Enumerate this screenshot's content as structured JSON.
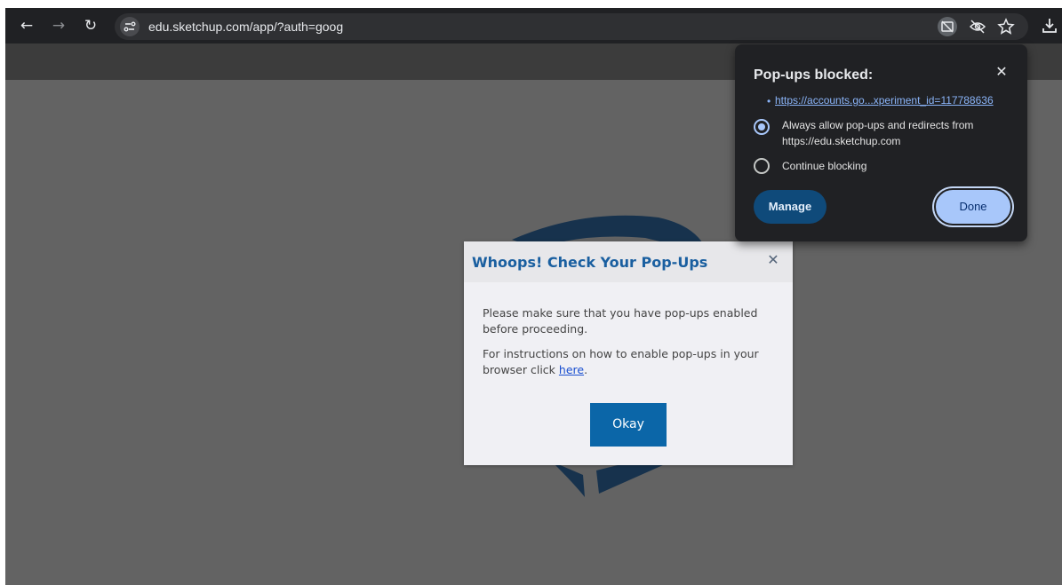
{
  "browser": {
    "url": "edu.sketchup.com/app/?auth=goog",
    "back_icon": "arrow-left-icon",
    "forward_icon": "arrow-right-icon",
    "reload_icon": "reload-icon",
    "site_info_icon": "tune-icon",
    "omnibox_icons": [
      "popup-blocked-icon",
      "eye-off-icon",
      "star-icon"
    ],
    "download_icon": "download-icon"
  },
  "dialog": {
    "title": "Whoops! Check Your Pop-Ups",
    "message": "Please make sure that you have pop-ups enabled before proceeding.",
    "instructions_prefix": "For instructions on how to enable pop-ups in your browser click ",
    "link_text": "here",
    "instructions_suffix": ".",
    "okay_label": "Okay",
    "title_color": "#1a5fa0",
    "button_color": "#0b66a8"
  },
  "popup_blocked": {
    "title": "Pop-ups blocked:",
    "blocked_url": "https://accounts.go...xperiment_id=117788636",
    "options": [
      {
        "label_line1": "Always allow pop-ups and redirects from",
        "label_line2": "https://edu.sketchup.com",
        "selected": true
      },
      {
        "label_line1": "Continue blocking",
        "label_line2": "",
        "selected": false
      }
    ],
    "manage_label": "Manage",
    "done_label": "Done"
  }
}
